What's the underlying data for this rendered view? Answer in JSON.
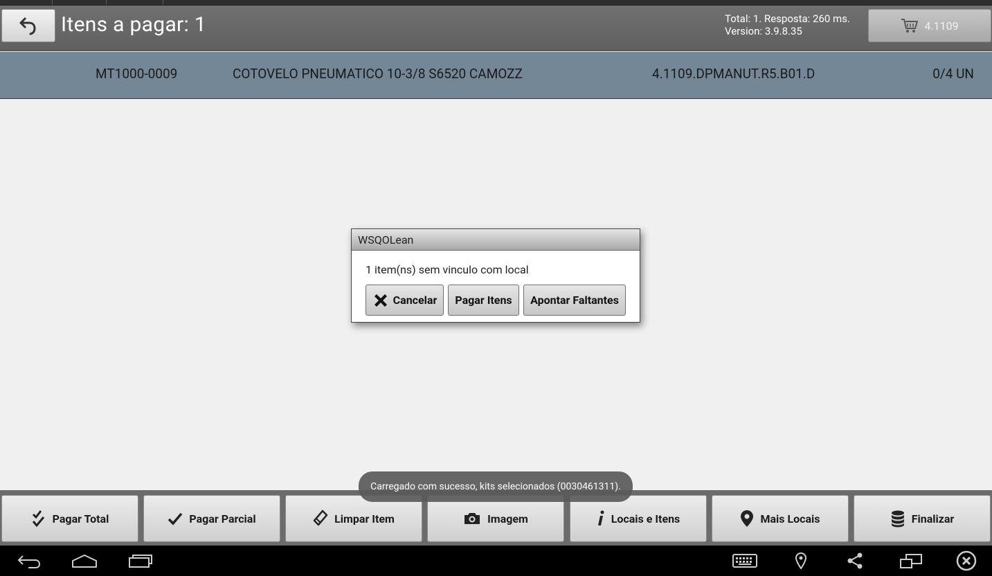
{
  "header": {
    "title": "Itens a pagar: 1",
    "info_line1": "Total: 1. Resposta: 260 ms.",
    "info_line2": "Version: 3.9.8.35",
    "cart_label": "4.1109"
  },
  "item": {
    "code": "MT1000-0009",
    "description": "COTOVELO PNEUMATICO 10-3/8 S6520 CAMOZZ",
    "location": "4.1109.DPMANUT.R5.B01.D",
    "quantity": "0/4 UN"
  },
  "dialog": {
    "title": "WSQOLean",
    "message": "1 item(ns) sem vinculo com local",
    "cancel_label": "Cancelar",
    "pay_label": "Pagar Itens",
    "missing_label": "Apontar Faltantes"
  },
  "toast": {
    "text": "Carregado com sucesso, kits selecionados (0030461311)."
  },
  "toolbar": {
    "pay_total": "Pagar Total",
    "pay_partial": "Pagar Parcial",
    "clear_item": "Limpar Item",
    "image": "Imagem",
    "locations_items": "Locais e Itens",
    "more_locations": "Mais Locais",
    "finish": "Finalizar"
  },
  "colors": {
    "header_bg": "#666666",
    "item_row_bg": "#748797",
    "toolbar_bg": "#6b6b6b",
    "navbar_bg": "#000000",
    "content_bg": "#f0f0f0"
  }
}
